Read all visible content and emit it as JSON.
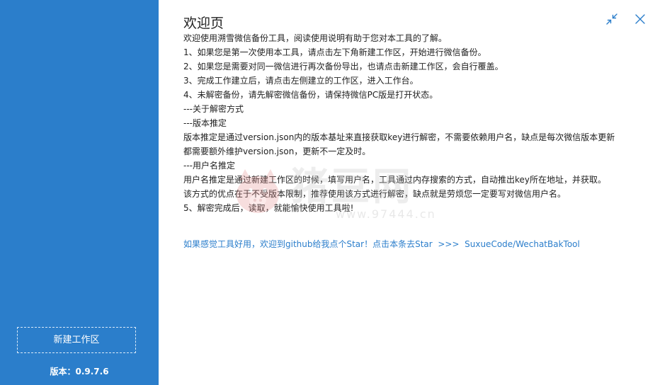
{
  "sidebar": {
    "new_workspace_label": "新建工作区",
    "version_label": "版本：",
    "version_value": "0.9.7.6"
  },
  "main": {
    "title": "欢迎页",
    "lines": [
      "欢迎使用溯雪微信备份工具，阅读使用说明有助于您对本工具的了解。",
      "1、如果您是第一次使用本工具，请点击左下角新建工作区，开始进行微信备份。",
      "2、如果您是需要对同一微信进行再次备份导出，也请点击新建工作区，会自行覆盖。",
      "3、完成工作建立后，请点击左侧建立的工作区，进入工作台。",
      "4、未解密备份，请先解密微信备份，请保持微信PC版是打开状态。",
      "---关于解密方式",
      "---版本推定",
      "版本推定是通过version.json内的版本基址来直接获取key进行解密，不需要依赖用户名，缺点是每次微信版本更新",
      "都需要额外维护version.json，更新不一定及时。",
      "---用户名推定",
      "用户名推定是通过新建工作区的时候，填写用户名，工具通过内存搜索的方式，自动推出key所在地址，并获取。",
      "该方式的优点在于不受版本限制，推荐使用该方式进行解密，缺点就是劳烦您一定要写对微信用户名。",
      "5、解密完成后，读取，就能愉快使用工具啦!"
    ],
    "github_link": "如果感觉工具好用，欢迎到github给我点个Star！点击本条去Star  >>>  SuxueCode/WechatBakTool"
  },
  "watermark": {
    "text": "猪豆网",
    "url": "www.97444.cn"
  },
  "colors": {
    "sidebar_bg": "#2b7ecb",
    "link": "#2b7ecb",
    "text": "#222222"
  }
}
